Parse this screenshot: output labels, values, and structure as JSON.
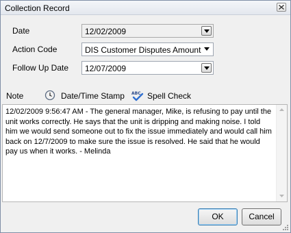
{
  "window": {
    "title": "Collection Record"
  },
  "form": {
    "date": {
      "label": "Date",
      "value": "12/02/2009"
    },
    "action_code": {
      "label": "Action Code",
      "value": "DIS Customer Disputes Amount Owed"
    },
    "follow_up_date": {
      "label": "Follow Up Date",
      "value": "12/07/2009"
    }
  },
  "toolbar": {
    "note_label": "Note",
    "datetime_stamp_label": "Date/Time Stamp",
    "spell_check_label": "Spell Check",
    "spell_check_icon_text": "ABC"
  },
  "note": {
    "text": "12/02/2009 9:56:47 AM - The general manager, Mike, is refusing to pay until the unit works correctly.  He says that the unit is dripping and making noise.  I told him we would send someone out to fix the issue immediately and would call him back on 12/7/2009 to make sure the issue is resolved.  He said that he would pay us when it works. - Melinda"
  },
  "buttons": {
    "ok_label": "OK",
    "cancel_label": "Cancel"
  },
  "icons": {
    "close": "close-icon",
    "dropdown": "chevron-down-icon",
    "datetime": "clock-icon",
    "spellcheck": "spell-check-icon"
  },
  "colors": {
    "title_bar": "#e3e7ee",
    "dialog_bg": "#f0f0f0",
    "default_button_border": "#3c7fb1"
  }
}
